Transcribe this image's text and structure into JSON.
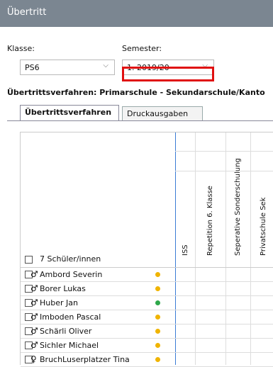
{
  "window": {
    "title": "Übertritt"
  },
  "filters": {
    "klasse_label": "Klasse:",
    "klasse_value": "PS6",
    "semester_label": "Semester:",
    "semester_value": "1. 2019/20"
  },
  "procedure": {
    "text": "Übertrittsverfahren: Primarschule - Sekundarschule/Kanto"
  },
  "tabs": [
    {
      "label": "Übertrittsverfahren",
      "active": true
    },
    {
      "label": "Druckausgaben",
      "active": false
    }
  ],
  "table": {
    "student_count_label": "7 Schüler/innen",
    "columns": [
      "ISS",
      "Repetition 6. Klasse",
      "Seperative Sonderschulung",
      "Privatschule Sek"
    ],
    "rows": [
      {
        "gender": "♂",
        "name": "Ambord Severin",
        "status_color": "#f0b400"
      },
      {
        "gender": "♂",
        "name": "Borer Lukas",
        "status_color": "#f0b400"
      },
      {
        "gender": "♂",
        "name": "Huber Jan",
        "status_color": "#2ea84a"
      },
      {
        "gender": "♂",
        "name": "Imboden Pascal",
        "status_color": "#f0b400"
      },
      {
        "gender": "♂",
        "name": "Schärli Oliver",
        "status_color": "#f0b400"
      },
      {
        "gender": "♂",
        "name": "Sichler Michael",
        "status_color": "#f0b400"
      },
      {
        "gender": "♀",
        "name": "BruchLuserplatzer Tina",
        "status_color": "#f0b400"
      }
    ]
  }
}
